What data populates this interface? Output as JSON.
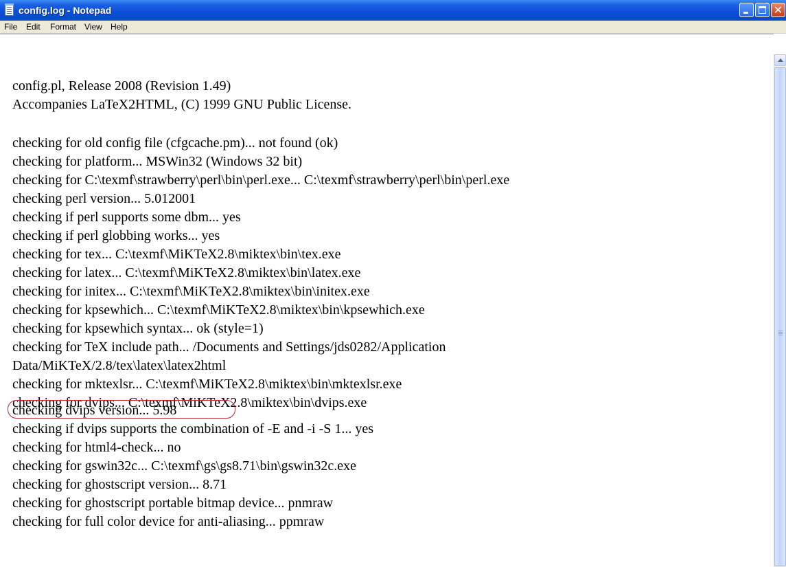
{
  "window": {
    "title": "config.log - Notepad",
    "icon": "notepad-icon",
    "title_bar_color": "#0a4ed8",
    "close_symbol": "✕"
  },
  "menu": [
    "File",
    "Edit",
    "Format",
    "View",
    "Help"
  ],
  "document": {
    "lines": [
      "config.pl, Release 2008 (Revision 1.49)",
      "Accompanies LaTeX2HTML, (C) 1999 GNU Public License.",
      "",
      "checking for old config file (cfgcache.pm)... not found (ok)",
      "checking for platform... MSWin32 (Windows 32 bit)",
      "checking for C:\\texmf\\strawberry\\perl\\bin\\perl.exe... C:\\texmf\\strawberry\\perl\\bin\\perl.exe",
      "checking perl version... 5.012001",
      "checking if perl supports some dbm... yes",
      "checking if perl globbing works... yes",
      "checking for tex... C:\\texmf\\MiKTeX2.8\\miktex\\bin\\tex.exe",
      "checking for latex... C:\\texmf\\MiKTeX2.8\\miktex\\bin\\latex.exe",
      "checking for initex... C:\\texmf\\MiKTeX2.8\\miktex\\bin\\initex.exe",
      "checking for kpsewhich... C:\\texmf\\MiKTeX2.8\\miktex\\bin\\kpsewhich.exe",
      "checking for kpsewhich syntax... ok (style=1)",
      "checking for TeX include path... /Documents and Settings/jds0282/Application",
      "Data/MiKTeX/2.8/tex\\latex\\latex2html",
      "checking for mktexlsr... C:\\texmf\\MiKTeX2.8\\miktex\\bin\\mktexlsr.exe",
      "checking for dvips... C:\\texmf\\MiKTeX2.8\\miktex\\bin\\dvips.exe",
      "checking dvips version... 5.98",
      "checking if dvips supports the combination of -E and -i -S 1... yes",
      "checking for html4-check... no",
      "checking for gswin32c... C:\\texmf\\gs\\gs8.71\\bin\\gswin32c.exe",
      "checking for ghostscript version... 8.71",
      "checking for ghostscript portable bitmap device... pnmraw",
      "checking for full color device for anti-aliasing... ppmraw"
    ],
    "highlighted_line": "checking dvips version... 5.98",
    "highlight_color": "#c0282a"
  }
}
